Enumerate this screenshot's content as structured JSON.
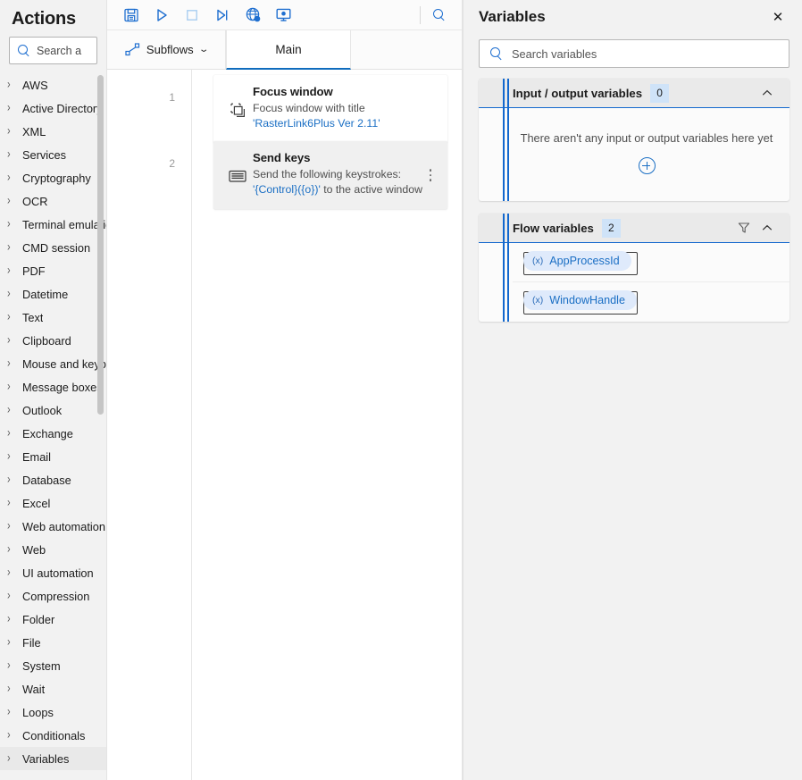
{
  "sidebar": {
    "title": "Actions",
    "search": {
      "placeholder": "Search a",
      "icon": "search-icon"
    },
    "items": [
      {
        "label": "Variables",
        "selected": true
      },
      {
        "label": "Conditionals",
        "selected": false
      },
      {
        "label": "Loops",
        "selected": false
      },
      {
        "label": "Wait",
        "selected": false
      },
      {
        "label": "System",
        "selected": false
      },
      {
        "label": "File",
        "selected": false
      },
      {
        "label": "Folder",
        "selected": false
      },
      {
        "label": "Compression",
        "selected": false
      },
      {
        "label": "UI automation",
        "selected": false
      },
      {
        "label": "Web",
        "selected": false
      },
      {
        "label": "Web automation",
        "selected": false
      },
      {
        "label": "Excel",
        "selected": false
      },
      {
        "label": "Database",
        "selected": false
      },
      {
        "label": "Email",
        "selected": false
      },
      {
        "label": "Exchange",
        "selected": false
      },
      {
        "label": "Outlook",
        "selected": false
      },
      {
        "label": "Message boxes",
        "selected": false
      },
      {
        "label": "Mouse and keyboard",
        "selected": false
      },
      {
        "label": "Clipboard",
        "selected": false
      },
      {
        "label": "Text",
        "selected": false
      },
      {
        "label": "Datetime",
        "selected": false
      },
      {
        "label": "PDF",
        "selected": false
      },
      {
        "label": "CMD session",
        "selected": false
      },
      {
        "label": "Terminal emulation",
        "selected": false
      },
      {
        "label": "OCR",
        "selected": false
      },
      {
        "label": "Cryptography",
        "selected": false
      },
      {
        "label": "Services",
        "selected": false
      },
      {
        "label": "XML",
        "selected": false
      },
      {
        "label": "Active Directory",
        "selected": false
      },
      {
        "label": "AWS",
        "selected": false
      }
    ]
  },
  "toolbar": {
    "buttons": [
      {
        "name": "save-icon",
        "label": "Save"
      },
      {
        "name": "run-icon",
        "label": "Run"
      },
      {
        "name": "stop-icon",
        "label": "Stop"
      },
      {
        "name": "run-next-action-icon",
        "label": "Run next action"
      },
      {
        "name": "web-recorder-icon",
        "label": "Web recorder"
      },
      {
        "name": "desktop-recorder-icon",
        "label": "Desktop recorder"
      }
    ],
    "search": {
      "name": "search-icon",
      "label": "Search"
    }
  },
  "tabs": {
    "subflows": {
      "label": "Subflows",
      "icon": "subflows-icon",
      "chevron": "⌄"
    },
    "items": [
      {
        "label": "Main",
        "active": true
      }
    ]
  },
  "flow": {
    "actions": [
      {
        "number": "1",
        "title": "Focus window",
        "icon": "focus-window-icon",
        "selected": false,
        "desc_prefix": "Focus window with title ",
        "desc_highlight": "'RasterLink6Plus Ver 2.11'",
        "desc_suffix": ""
      },
      {
        "number": "2",
        "title": "Send keys",
        "icon": "keyboard-icon",
        "selected": true,
        "desc_prefix": "Send the following keystrokes: ",
        "desc_highlight": "'{Control}({o})'",
        "desc_suffix": " to the active window"
      }
    ]
  },
  "variables_panel": {
    "title": "Variables",
    "close_label": "✕",
    "search": {
      "placeholder": "Search variables",
      "icon": "search-icon"
    },
    "sections": [
      {
        "title": "Input / output variables",
        "count": "0",
        "collapsed": false,
        "chevron": "⌃",
        "has_filter": false,
        "empty_message": "There aren't any input or output variables here yet",
        "add_label": "+",
        "variables": []
      },
      {
        "title": "Flow variables",
        "count": "2",
        "collapsed": false,
        "chevron": "⌃",
        "has_filter": true,
        "empty_message": "",
        "add_label": "",
        "variables": [
          {
            "prefix": "(x)",
            "name": "AppProcessId"
          },
          {
            "prefix": "(x)",
            "name": "WindowHandle"
          }
        ]
      }
    ]
  },
  "colors": {
    "accent": "#1368ce",
    "link": "#1b6fc4",
    "toolbar_icon": "#1f6fd0",
    "badge_bg": "#cfe3f8",
    "pill_bg": "#dfeafb",
    "sidebar_bg": "#f2f2f2",
    "selected_card_bg": "#f0f0f0"
  }
}
